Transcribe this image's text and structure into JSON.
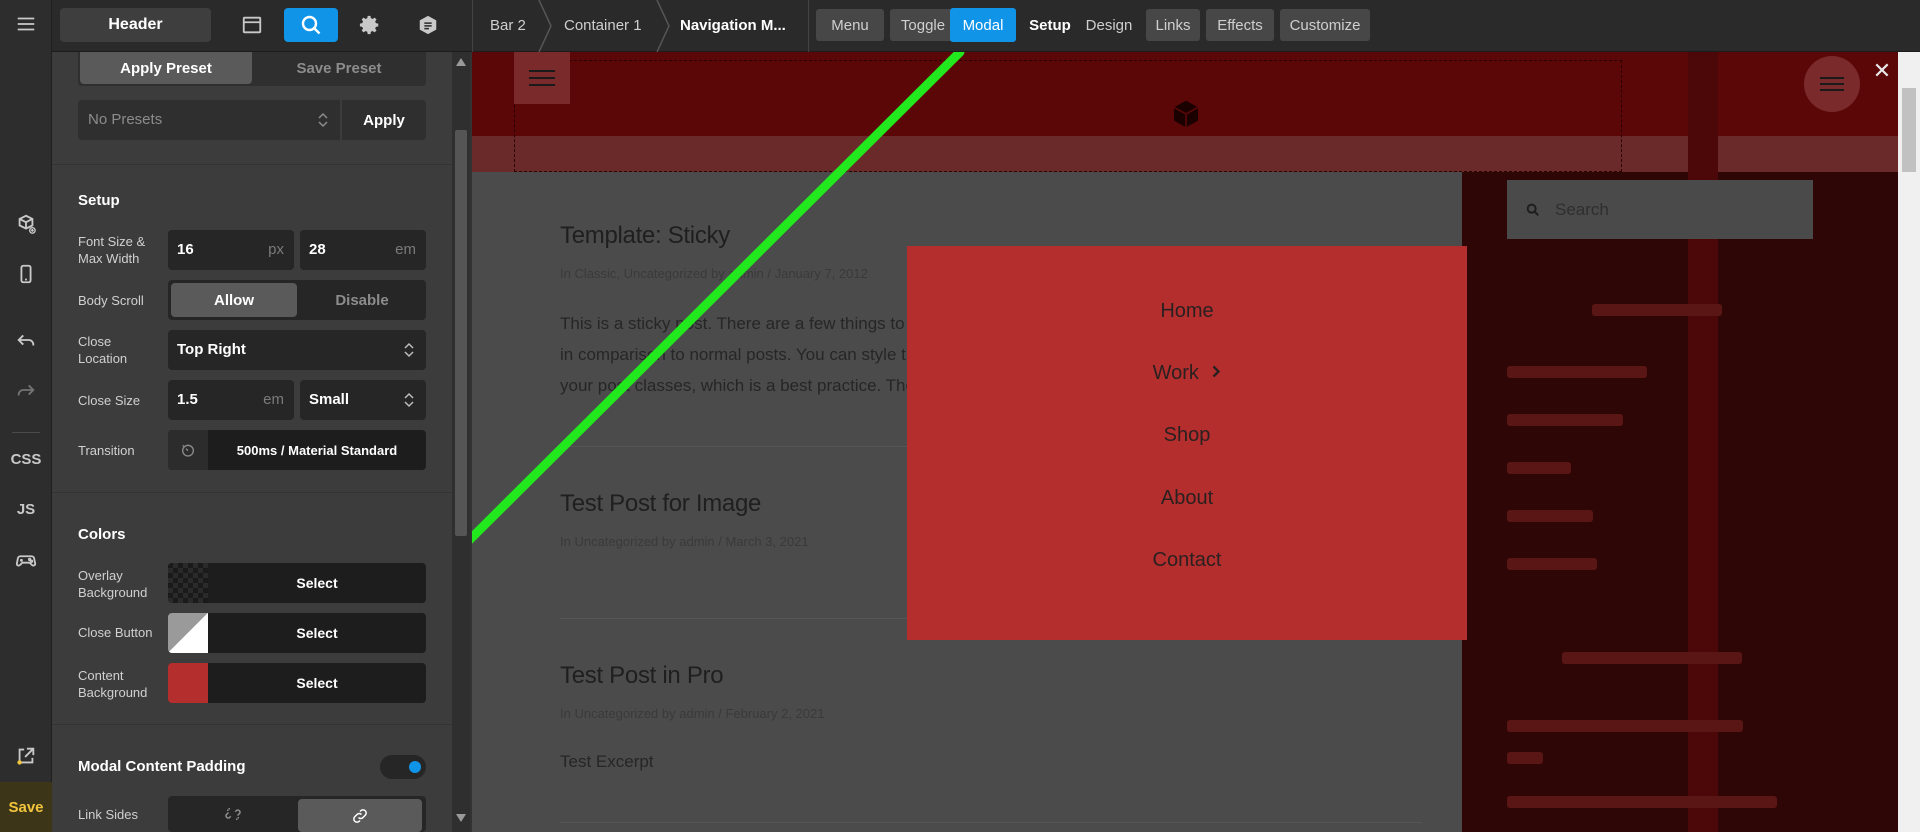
{
  "rail": {
    "css": "CSS",
    "js": "JS",
    "save": "Save"
  },
  "topbar": {
    "header_label": "Header",
    "breadcrumbs": [
      "Bar 2",
      "Container 1",
      "Navigation M..."
    ],
    "tabs": [
      "Menu",
      "Toggle",
      "Modal",
      "Setup",
      "Design",
      "Links",
      "Effects",
      "Customize"
    ],
    "active_tab": "Modal"
  },
  "panel": {
    "apply_preset": "Apply Preset",
    "save_preset": "Save Preset",
    "presets_select": "No Presets",
    "apply": "Apply",
    "setup_title": "Setup",
    "font_size_label": "Font Size & Max Width",
    "font_size_value": "16",
    "font_size_unit": "px",
    "max_width_value": "28",
    "max_width_unit": "em",
    "body_scroll_label": "Body Scroll",
    "body_scroll_on": "Allow",
    "body_scroll_off": "Disable",
    "close_location_label": "Close Location",
    "close_location_value": "Top Right",
    "close_size_label": "Close Size",
    "close_size_value": "1.5",
    "close_size_unit": "em",
    "close_size_preset": "Small",
    "transition_label": "Transition",
    "transition_value": "500ms / Material Standard",
    "colors_title": "Colors",
    "overlay_label": "Overlay Background",
    "close_button_label": "Close Button",
    "content_bg_label": "Content Background",
    "select": "Select",
    "content_bg_color": "#b42e2e",
    "padding_title": "Modal Content Padding",
    "padding_toggle": true,
    "link_sides_label": "Link Sides"
  },
  "preview": {
    "posts": [
      {
        "title": "Template: Sticky",
        "meta": "In Classic, Uncategorized by admin  /  January 7, 2012",
        "text": [
          "This is a sticky post. There are a few things to v",
          "in comparison to normal posts. You can style th",
          "your post classes, which is a best practice. The"
        ]
      },
      {
        "title": "Test Post for Image",
        "meta": "In Uncategorized by admin  /  March 3, 2021",
        "text": []
      },
      {
        "title": "Test Post in Pro",
        "meta": "In Uncategorized by admin  /  February 2, 2021",
        "text": [
          "Test Excerpt"
        ]
      }
    ],
    "search_placeholder": "Search",
    "modal_links": [
      "Home",
      "Work",
      "Shop",
      "About",
      "Contact"
    ],
    "close_glyph": "✕",
    "accent": "#0f94e8",
    "arrow_color": "#22e81e"
  }
}
